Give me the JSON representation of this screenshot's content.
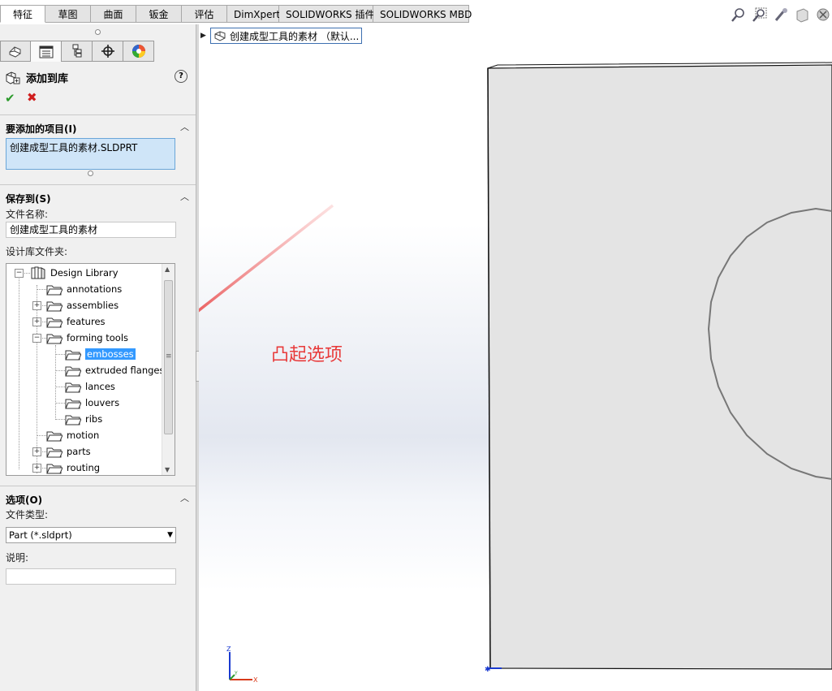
{
  "top_tabs": [
    "特征",
    "草图",
    "曲面",
    "钣金",
    "评估",
    "DimXpert",
    "SOLIDWORKS 插件",
    "SOLIDWORKS MBD"
  ],
  "active_tab": "特征",
  "view_tools": [
    "zoom-to-fit-icon",
    "zoom-area-icon",
    "previous-view-icon",
    "section-view-icon",
    "view-orientation-icon"
  ],
  "property_manager": {
    "manager_tabs": [
      "featuremanager-icon",
      "propertymanager-icon",
      "configurationmanager-icon",
      "dimxpertmanager-icon",
      "displaymanager-icon"
    ],
    "title": "添加到库",
    "help": "?",
    "items_to_add": {
      "title": "要添加的项目(I)",
      "item": "创建成型工具的素材.SLDPRT"
    },
    "save_to": {
      "title": "保存到(S)",
      "file_name_label": "文件名称:",
      "file_name_value": "创建成型工具的素材",
      "folder_label": "设计库文件夹:",
      "tree": {
        "root": "Design Library",
        "children": [
          {
            "label": "annotations",
            "expandable": false
          },
          {
            "label": "assemblies",
            "expandable": true
          },
          {
            "label": "features",
            "expandable": true
          },
          {
            "label": "forming tools",
            "expanded": true,
            "children": [
              "embosses",
              "extruded flanges",
              "lances",
              "louvers",
              "ribs"
            ]
          },
          {
            "label": "motion",
            "expandable": false
          },
          {
            "label": "parts",
            "expandable": true
          },
          {
            "label": "routing",
            "expandable": true
          }
        ],
        "selected": "embosses"
      }
    },
    "options": {
      "title": "选项(O)",
      "file_type_label": "文件类型:",
      "file_type_value": "Part (*.sldprt)",
      "description_label": "说明:",
      "description_value": ""
    }
  },
  "graphics": {
    "breadcrumb": "创建成型工具的素材 （默认...",
    "annotation": "凸起选项",
    "triad": {
      "x": "X",
      "y": "Y",
      "z": "Z"
    },
    "colors": {
      "annotation": "#e83a3a",
      "part_face": "#e4e4e4",
      "selection": "#3399ff"
    }
  }
}
